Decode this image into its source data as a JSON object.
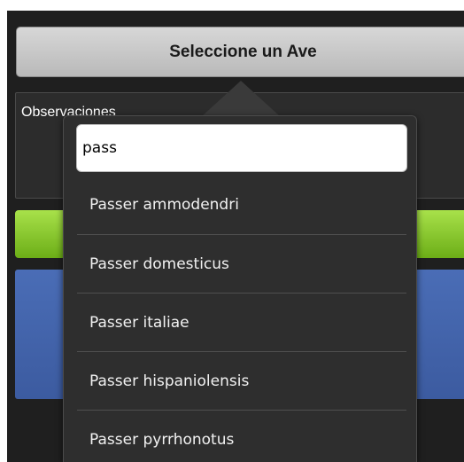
{
  "bird_select": {
    "label": "Seleccione un Ave"
  },
  "observations": {
    "label": "Observaciones"
  },
  "autocomplete": {
    "query": "pass",
    "suggestions": [
      "Passer ammodendri",
      "Passer domesticus",
      "Passer italiae",
      "Passer hispaniolensis",
      "Passer pyrrhonotus"
    ]
  },
  "colors": {
    "background": "#1f1f1f",
    "button_gray": "#c8c8c8",
    "accent_green": "#8cc63f",
    "accent_blue": "#4464a8",
    "popup": "#2e2e2e"
  }
}
